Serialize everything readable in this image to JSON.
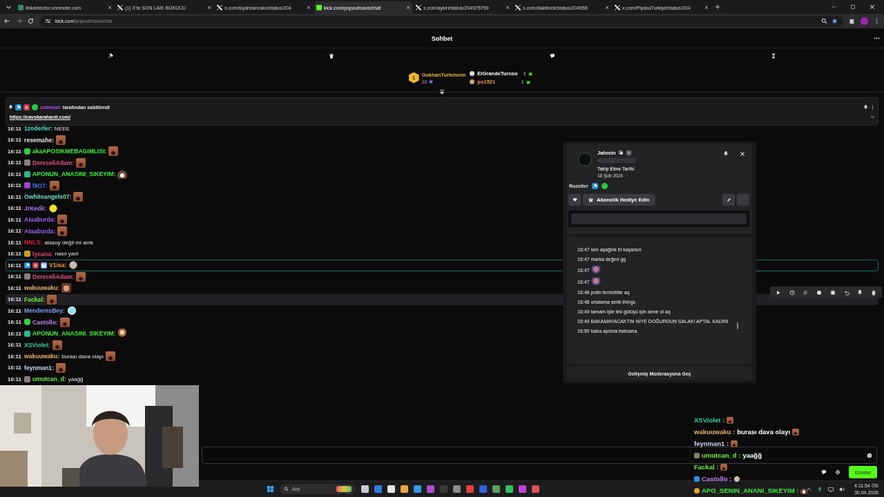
{
  "browser": {
    "tabs": [
      {
        "kind": "link",
        "title": "linkdetector.onrender.com",
        "selected": false
      },
      {
        "kind": "x",
        "title": "(1) X'te SON LAİK BÜKÜCÜ",
        "selected": false
      },
      {
        "kind": "x",
        "title": "x.com/siyahsancakx/status/204",
        "selected": false
      },
      {
        "kind": "kick",
        "title": "kick.com/popout/cavs/chat",
        "selected": true
      },
      {
        "kind": "x",
        "title": "x.com/aykiri/status/204975759",
        "selected": false
      },
      {
        "kind": "x",
        "title": "x.com/daktilock/status/204956",
        "selected": false
      },
      {
        "kind": "x",
        "title": "x.com/PiyasaTurkiye/status/204",
        "selected": false
      }
    ],
    "url_host": "kick.com",
    "url_path": "/popout/cavs/chat"
  },
  "chat_header": {
    "title": "Sohbet"
  },
  "mod_tools": [
    {
      "kind": "hammer"
    },
    {
      "kind": "trash"
    },
    {
      "kind": "chat"
    },
    {
      "kind": "hourglass"
    }
  ],
  "leaderboard": [
    {
      "kind": "rank",
      "rank": "1",
      "user": "GokhanTurkmenn",
      "count": "10",
      "color": "#f0b44a"
    },
    {
      "kind": "badge",
      "user": "ElGrandeTurcoo",
      "count": "3",
      "color": "#ffffff"
    },
    {
      "kind": "badge",
      "user": "po1521",
      "count": "1",
      "color": "#f0a040"
    }
  ],
  "pinned": {
    "badges": [
      {
        "kind": "moderator"
      },
      {
        "kind": "subscriber"
      },
      {
        "kind": "verified"
      }
    ],
    "user": "cotmoon",
    "color": "#b455f0",
    "text": "tarafından sabitlendi",
    "link": "https://cavskarahanli.com/"
  },
  "messages": [
    {
      "time": "16:11",
      "user": "1zoderler:",
      "color": "#5fd6c8",
      "text": "NEEE",
      "highlighted": false,
      "hovered": false
    },
    {
      "time": "16:11",
      "user": "resemahe:",
      "color": "#e6e6e6",
      "emote": {
        "kind": "brown"
      },
      "highlighted": false,
      "hovered": false
    },
    {
      "time": "16:11",
      "badges": [
        {
          "kind": "sub-green"
        }
      ],
      "user": "akaAPOSIKMEBAGIMLISI:",
      "color": "#3df03d",
      "emote": {
        "kind": "brown"
      },
      "highlighted": false,
      "hovered": false
    },
    {
      "time": "16:11",
      "badges": [
        {
          "kind": "avatar-grey"
        }
      ],
      "user": "DereceliAdam:",
      "color": "#e0507a",
      "emote": {
        "kind": "brown"
      },
      "highlighted": false,
      "hovered": false
    },
    {
      "time": "16:11",
      "badges": [
        {
          "kind": "avatar-teal"
        }
      ],
      "user": "APONUN_ANASINI_SIKEYIM:",
      "color": "#3df03d",
      "emote": {
        "kind": "grin"
      },
      "highlighted": false,
      "hovered": false
    },
    {
      "time": "16:11",
      "badges": [
        {
          "kind": "avatar-purple"
        }
      ],
      "user": "l9O7:",
      "color": "#4a78f0",
      "emote": {
        "kind": "brown"
      },
      "highlighted": false,
      "hovered": false
    },
    {
      "time": "16:11",
      "user": "Owhiteangels07:",
      "color": "#6ee0c8",
      "emote": {
        "kind": "brown"
      },
      "highlighted": false,
      "hovered": false
    },
    {
      "time": "16:11",
      "user": "JrKedii:",
      "color": "#b07cf0",
      "emote": {
        "kind": "yellow"
      },
      "highlighted": false,
      "hovered": false
    },
    {
      "time": "16:11",
      "user": "Ataaburda:",
      "color": "#a060f0",
      "emote": {
        "kind": "brown"
      },
      "highlighted": false,
      "hovered": false
    },
    {
      "time": "16:11",
      "user": "Ataaburda:",
      "color": "#a060f0",
      "emote": {
        "kind": "brown"
      },
      "highlighted": false,
      "hovered": false
    },
    {
      "time": "16:11",
      "user": "NNLS:",
      "color": "#e02040",
      "text": "atasoy değil mi amk",
      "highlighted": false,
      "hovered": false
    },
    {
      "time": "16:11",
      "badges": [
        {
          "kind": "avatar-yellow"
        }
      ],
      "user": "lycana:",
      "color": "#e0406a",
      "text": "nasıl yani",
      "highlighted": false,
      "hovered": false
    },
    {
      "time": "16:11",
      "badges": [
        {
          "kind": "moderator"
        },
        {
          "kind": "subscriber"
        },
        {
          "kind": "gifter"
        }
      ],
      "user": "V1isa:",
      "color": "#f0a030",
      "emote": {
        "kind": "grey"
      },
      "highlighted": true,
      "hovered": false
    },
    {
      "time": "16:11",
      "badges": [
        {
          "kind": "avatar-grey"
        }
      ],
      "user": "DereceliAdam:",
      "color": "#e0507a",
      "emote": {
        "kind": "brown"
      },
      "highlighted": false,
      "hovered": false
    },
    {
      "time": "16:11",
      "user": "wakuuwaku:",
      "color": "#e8b070",
      "emote": {
        "kind": "face"
      },
      "highlighted": false,
      "hovered": false
    },
    {
      "time": "16:11",
      "user": "Fackal:",
      "color": "#6ef040",
      "emote": {
        "kind": "brown"
      },
      "highlighted": false,
      "hovered": true
    },
    {
      "time": "16:11",
      "user": "MenderesBey:",
      "color": "#7aa0f0",
      "emote": {
        "kind": "cyan"
      },
      "highlighted": false,
      "hovered": false
    },
    {
      "time": "16:11",
      "badges": [
        {
          "kind": "sub-green"
        }
      ],
      "user": "Castollo:",
      "color": "#c080f0",
      "emote": {
        "kind": "brown"
      },
      "highlighted": false,
      "hovered": false
    },
    {
      "time": "16:11",
      "badges": [
        {
          "kind": "avatar-teal"
        }
      ],
      "user": "APONUN_ANASINI_SIKEYIM:",
      "color": "#3df03d",
      "emote": {
        "kind": "anime"
      },
      "highlighted": false,
      "hovered": false
    },
    {
      "time": "16:11",
      "user": "XSViolet:",
      "color": "#30d0a0",
      "emote": {
        "kind": "brown"
      },
      "highlighted": false,
      "hovered": false
    },
    {
      "time": "16:11",
      "user": "wakuuwaku:",
      "color": "#e8b070",
      "text": "burası dava olayı",
      "emote": {
        "kind": "brown"
      },
      "highlighted": false,
      "hovered": false
    },
    {
      "time": "16:11",
      "user": "feynman1:",
      "color": "#c8d8f0",
      "emote": {
        "kind": "brown"
      },
      "highlighted": false,
      "hovered": false
    },
    {
      "time": "16:11",
      "badges": [
        {
          "kind": "avatar-grey"
        }
      ],
      "user": "umutcan_d:",
      "color": "#6ef040",
      "text": "yaağğ",
      "highlighted": false,
      "hovered": false
    }
  ],
  "user_card": {
    "user": "Jahrein",
    "follow_label": "Takip Etme Tarihi",
    "follow_date": "16 Şub 2024",
    "badges_label": "Rozetler",
    "badges": [
      {
        "kind": "moderator"
      },
      {
        "kind": "verified"
      }
    ],
    "gift_label": "Abonelik Hediye Edin",
    "history": [
      {
        "time": "16:47",
        "text": "sen aşağılık bi kaşarsın"
      },
      {
        "time": "16:47",
        "text": "marka değeri gg"
      },
      {
        "time": "16:47",
        "emote": {
          "kind": "pink"
        }
      },
      {
        "time": "16:47",
        "emote": {
          "kind": "pink"
        }
      },
      {
        "time": "16:48",
        "text": "putin temizlikte aq"
      },
      {
        "time": "16:48",
        "text": "ortalama serik things"
      },
      {
        "time": "16:49",
        "text": "tamam işte tek gülüşü için anne ol aq"
      },
      {
        "time": "16:49",
        "text": "BAKAMAYACAKTIN NİYE DOĞURDUN SALAK! APTAL KADIN!"
      },
      {
        "time": "16:50",
        "text": "baba aydına baksana"
      }
    ],
    "advanced_label": "Gelişmiş Moderasyona Geç"
  },
  "message_actions": [
    {
      "kind": "play"
    },
    {
      "kind": "clock"
    },
    {
      "kind": "slash"
    },
    {
      "kind": "circle"
    },
    {
      "kind": "square"
    },
    {
      "kind": "undo"
    },
    {
      "kind": "pin"
    },
    {
      "kind": "trash"
    }
  ],
  "chat_input": {
    "send_label": "Gönder"
  },
  "stream_overlay_chat": [
    {
      "user": "XSViolet :",
      "color": "#30d0a0",
      "emote": {
        "kind": "brown"
      }
    },
    {
      "user": "wakuuwaku :",
      "color": "#e8b070",
      "text": "burası dava olayı",
      "emote": {
        "kind": "brown"
      }
    },
    {
      "user": "feynman1 :",
      "color": "#c8d8f0",
      "emote": {
        "kind": "brown"
      }
    },
    {
      "badge": {
        "kind": "avatar-grey"
      },
      "user": "umutcan_d :",
      "color": "#6ef040",
      "text": "yaağğ"
    },
    {
      "user": "Fackal :",
      "color": "#6ef040",
      "emote": {
        "kind": "brown"
      }
    },
    {
      "badge": {
        "kind": "cube"
      },
      "user": "Castollo :",
      "color": "#c080f0",
      "emote": {
        "kind": "grey"
      }
    },
    {
      "badge": {
        "kind": "gold"
      },
      "user": "APO_SENIN_ANANI_SIKEYIM :",
      "color": "#3df03d",
      "emote": {
        "kind": "grin"
      }
    }
  ],
  "taskbar": {
    "search_placeholder": "Ara",
    "time": "4:11:54 ÖS",
    "date": "30.04.2026"
  }
}
